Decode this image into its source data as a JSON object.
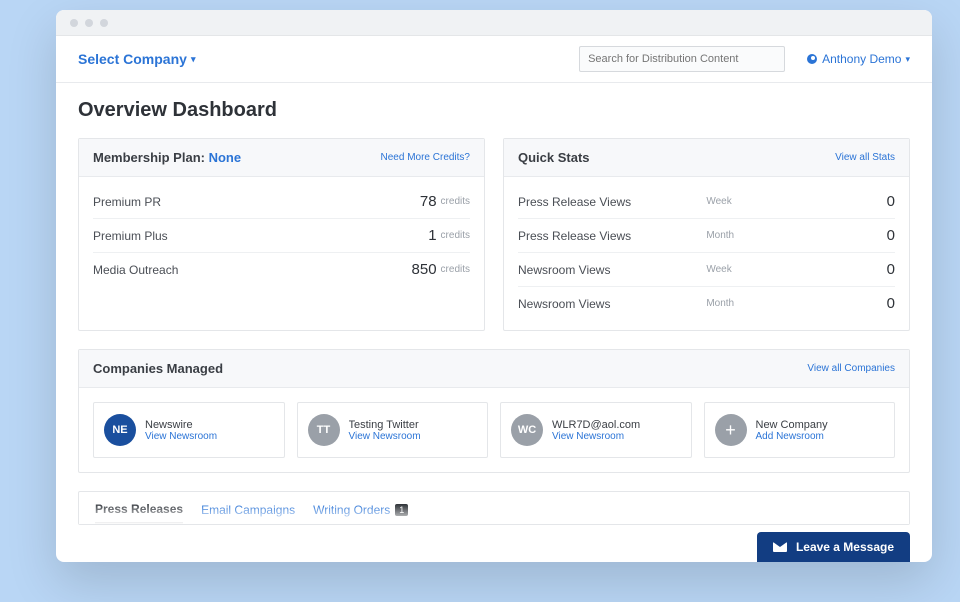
{
  "topbar": {
    "company_selector": "Select Company",
    "search_placeholder": "Search for Distribution Content",
    "user_name": "Anthony Demo"
  },
  "page_title": "Overview Dashboard",
  "membership": {
    "title_prefix": "Membership Plan: ",
    "plan": "None",
    "more_credits": "Need More Credits?",
    "rows": [
      {
        "name": "Premium PR",
        "value": "78",
        "unit": "credits"
      },
      {
        "name": "Premium Plus",
        "value": "1",
        "unit": "credits"
      },
      {
        "name": "Media Outreach",
        "value": "850",
        "unit": "credits"
      }
    ]
  },
  "quick_stats": {
    "title": "Quick Stats",
    "view_all": "View all Stats",
    "rows": [
      {
        "name": "Press Release Views",
        "period": "Week",
        "value": "0"
      },
      {
        "name": "Press Release Views",
        "period": "Month",
        "value": "0"
      },
      {
        "name": "Newsroom Views",
        "period": "Week",
        "value": "0"
      },
      {
        "name": "Newsroom Views",
        "period": "Month",
        "value": "0"
      }
    ]
  },
  "companies": {
    "title": "Companies Managed",
    "view_all": "View all Companies",
    "cards": [
      {
        "initials": "NE",
        "name": "Newswire",
        "link": "View Newsroom",
        "color": "blue"
      },
      {
        "initials": "TT",
        "name": "Testing Twitter",
        "link": "View Newsroom",
        "color": "gray"
      },
      {
        "initials": "WC",
        "name": "WLR7D@aol.com",
        "link": "View Newsroom",
        "color": "gray"
      },
      {
        "initials": "+",
        "name": "New Company",
        "link": "Add Newsroom",
        "color": "plus"
      }
    ]
  },
  "tabs": {
    "items": [
      {
        "label": "Press Releases",
        "active": true,
        "badge": ""
      },
      {
        "label": "Email Campaigns",
        "active": false,
        "badge": ""
      },
      {
        "label": "Writing Orders",
        "active": false,
        "badge": "1"
      }
    ]
  },
  "chat": {
    "label": "Leave a Message"
  }
}
